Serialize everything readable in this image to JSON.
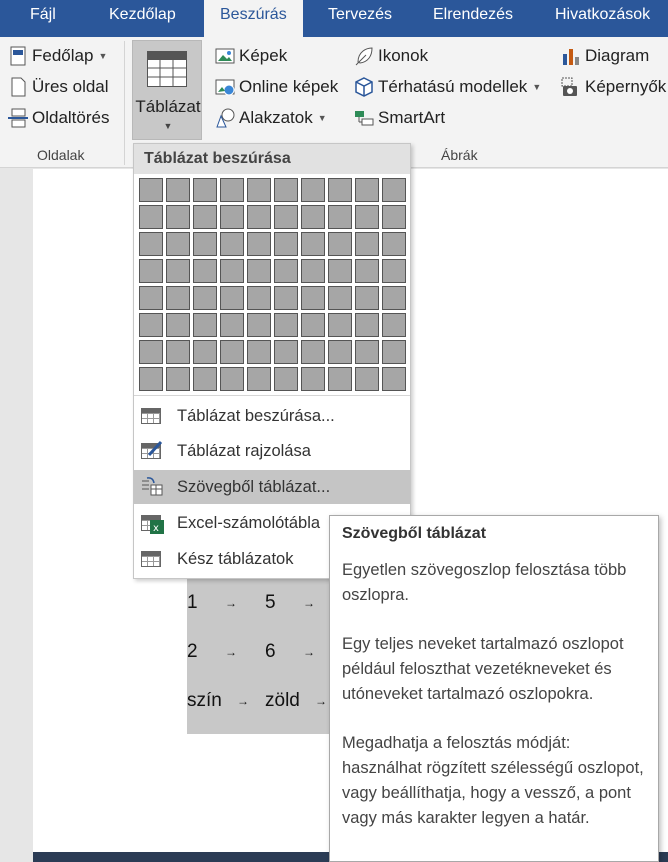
{
  "tabs": [
    "Fájl",
    "Kezdőlap",
    "Beszúrás",
    "Tervezés",
    "Elrendezés",
    "Hivatkozások"
  ],
  "ribbon": {
    "pages": {
      "cover": "Fedőlap",
      "blank": "Üres oldal",
      "break": "Oldaltörés",
      "group_label": "Oldalak"
    },
    "table": {
      "label": "Táblázat"
    },
    "illustrations": {
      "pictures": "Képek",
      "online_pictures": "Online képek",
      "shapes": "Alakzatok",
      "icons": "Ikonok",
      "models": "Térhatású modellek",
      "smartart": "SmartArt",
      "chart": "Diagram",
      "screenshot": "Képernyők",
      "group_label": "Ábrák"
    }
  },
  "menu": {
    "title": "Táblázat beszúrása",
    "grid": {
      "cols": 10,
      "rows": 8
    },
    "items": [
      {
        "label": "Táblázat beszúrása...",
        "icon": "table-icon"
      },
      {
        "label": "Táblázat rajzolása",
        "icon": "draw-table-icon"
      },
      {
        "label": "Szövegből táblázat...",
        "icon": "text-to-table-icon",
        "highlighted": true
      },
      {
        "label": "Excel-számolótábla",
        "icon": "excel-icon"
      },
      {
        "label": "Kész táblázatok",
        "icon": "quick-tables-icon"
      }
    ]
  },
  "tooltip": {
    "title": "Szövegből táblázat",
    "p1": "Egyetlen szövegoszlop felosztása több oszlopra.",
    "p2": "Egy teljes neveket tartalmazó oszlopot például feloszthat vezetékneveket és utóneveket tartalmazó oszlopokra.",
    "p3": "Megadhatja a felosztás módját: használhat rögzített szélességű oszlopot, vagy beállíthatja, hogy a vessző, a pont vagy más karakter legyen a határ."
  },
  "document": {
    "rows": [
      [
        "1",
        "5"
      ],
      [
        "2",
        "6"
      ],
      [
        "szín",
        "zöld"
      ]
    ],
    "tab_char": "→"
  },
  "colors": {
    "accent": "#2b579a",
    "ribbon": "#f3f3f3"
  }
}
